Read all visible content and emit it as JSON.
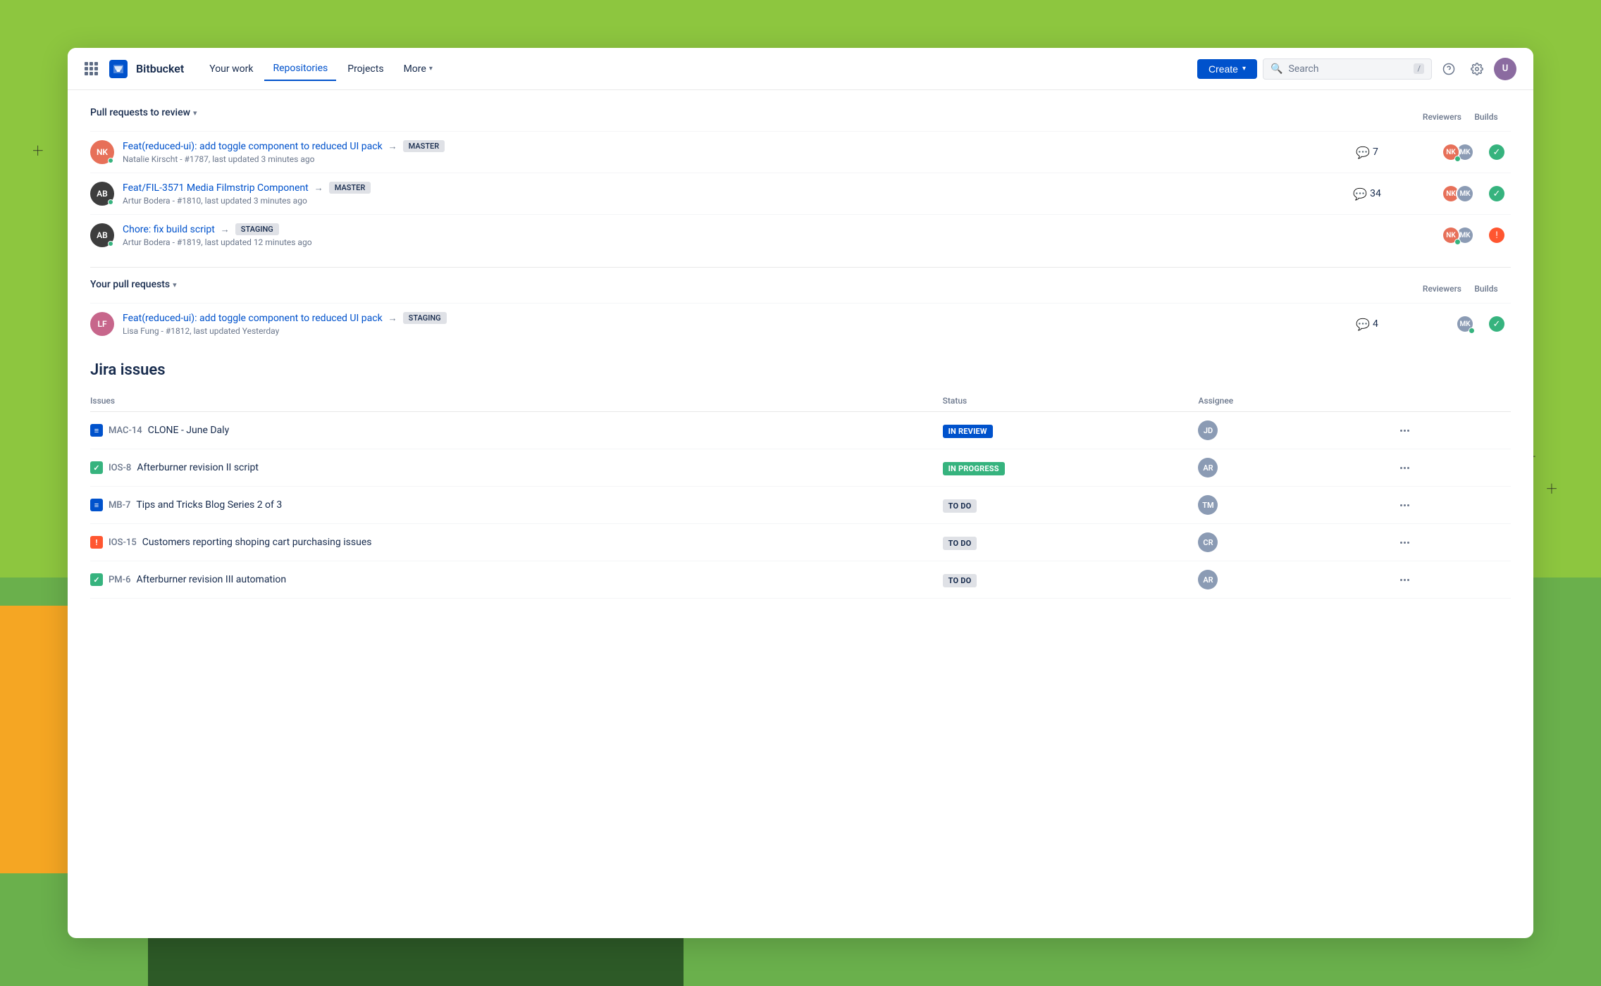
{
  "background": {
    "colors": {
      "main": "#6ab04c",
      "light_green": "#8dc63f",
      "dark_green": "#2d5a27",
      "orange": "#f5a623"
    }
  },
  "navbar": {
    "app_name": "Bitbucket",
    "nav_items": [
      {
        "id": "your-work",
        "label": "Your work",
        "active": false
      },
      {
        "id": "repositories",
        "label": "Repositories",
        "active": true
      },
      {
        "id": "projects",
        "label": "Projects",
        "active": false
      },
      {
        "id": "more",
        "label": "More",
        "has_arrow": true
      }
    ],
    "create_button": "Create",
    "search_placeholder": "Search",
    "search_shortcut": "/"
  },
  "pull_requests_to_review": {
    "section_label": "Pull requests to review",
    "col_reviewers": "Reviewers",
    "col_builds": "Builds",
    "items": [
      {
        "id": "pr1",
        "title": "Feat(reduced-ui): add toggle component to reduced UI pack",
        "branch": "MASTER",
        "author": "Natalie Kirscht",
        "pr_number": "#1787",
        "updated": "last updated  3 minutes ago",
        "comments": 7,
        "build": "success",
        "avatar_bg": "av-coral",
        "avatar_initials": "NK"
      },
      {
        "id": "pr2",
        "title": "Feat/FIL-3571 Media Filmstrip Component",
        "branch": "MASTER",
        "author": "Artur Bodera",
        "pr_number": "#1810",
        "updated": "last updated 3 minutes ago",
        "comments": 34,
        "build": "success",
        "avatar_bg": "av-dark",
        "avatar_initials": "AB"
      },
      {
        "id": "pr3",
        "title": "Chore: fix build script",
        "branch": "STAGING",
        "author": "Artur Bodera",
        "pr_number": "#1819",
        "updated": "last updated  12 minutes ago",
        "comments": null,
        "build": "error",
        "avatar_bg": "av-dark",
        "avatar_initials": "AB"
      }
    ]
  },
  "your_pull_requests": {
    "section_label": "Your pull requests",
    "col_reviewers": "Reviewers",
    "col_builds": "Builds",
    "items": [
      {
        "id": "pr4",
        "title": "Feat(reduced-ui): add toggle component to reduced UI pack",
        "branch": "STAGING",
        "author": "Lisa Fung",
        "pr_number": "#1812",
        "updated": "last updated Yesterday",
        "comments": 4,
        "build": "success",
        "avatar_bg": "av-pink",
        "avatar_initials": "LF"
      }
    ]
  },
  "jira_issues": {
    "title": "Jira issues",
    "col_issues": "Issues",
    "col_status": "Status",
    "col_assignee": "Assignee",
    "items": [
      {
        "id": "mac-14",
        "issue_id": "MAC-14",
        "title": "CLONE - June Daly",
        "status": "IN REVIEW",
        "status_type": "in-review",
        "icon_type": "blue",
        "assignee_initials": "JD",
        "assignee_bg": "av-muted"
      },
      {
        "id": "ios-8",
        "issue_id": "IOS-8",
        "title": "Afterburner revision II script",
        "status": "IN PROGRESS",
        "status_type": "in-progress",
        "icon_type": "green",
        "assignee_initials": "AR",
        "assignee_bg": "av-muted"
      },
      {
        "id": "mb-7",
        "issue_id": "MB-7",
        "title": "Tips and Tricks Blog Series 2 of 3",
        "status": "TO DO",
        "status_type": "to-do",
        "icon_type": "blue",
        "assignee_initials": "TM",
        "assignee_bg": "av-muted"
      },
      {
        "id": "ios-15",
        "issue_id": "IOS-15",
        "title": "Customers reporting shoping cart purchasing issues",
        "status": "TO DO",
        "status_type": "to-do",
        "icon_type": "red",
        "assignee_initials": "CR",
        "assignee_bg": "av-muted"
      },
      {
        "id": "pm-6",
        "issue_id": "PM-6",
        "title": "Afterburner revision III automation",
        "status": "TO DO",
        "status_type": "to-do",
        "icon_type": "green",
        "assignee_initials": "AR",
        "assignee_bg": "av-muted"
      }
    ]
  }
}
